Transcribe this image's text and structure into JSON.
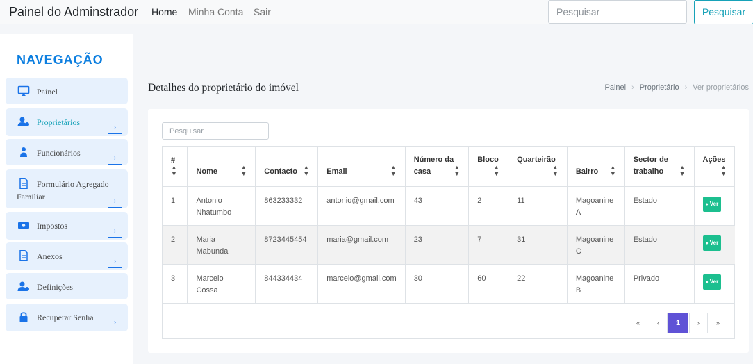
{
  "navbar": {
    "brand": "Painel do Adminstrador",
    "links": [
      "Home",
      "Minha Conta",
      "Sair"
    ],
    "search_placeholder": "Pesquisar",
    "search_button": "Pesquisar"
  },
  "sidebar": {
    "title": "NAVEGAÇÃO",
    "items": [
      {
        "label": "Painel",
        "icon": "monitor-icon"
      },
      {
        "label": "Proprietários",
        "icon": "user-group-icon",
        "active": true
      },
      {
        "label": "Funcionários",
        "icon": "worker-icon"
      },
      {
        "label": "Formulário Agregado Familiar",
        "icon": "document-icon"
      },
      {
        "label": "Impostos",
        "icon": "money-icon"
      },
      {
        "label": "Anexos",
        "icon": "document-icon"
      },
      {
        "label": "Definições",
        "icon": "user-group-icon"
      },
      {
        "label": "Recuperar Senha",
        "icon": "lock-icon"
      }
    ],
    "chevron": "›"
  },
  "page": {
    "title": "Detalhes do proprietário do imóvel",
    "breadcrumb": [
      "Painel",
      "Proprietário",
      "Ver proprietários"
    ],
    "breadcrumb_sep": "›"
  },
  "table": {
    "search_placeholder": "Pesquisar",
    "sort_icon": "sort-icon",
    "columns": [
      "#",
      "Nome",
      "Contacto",
      "Email",
      "Número da casa",
      "Bloco",
      "Quarteirão",
      "Bairro",
      "Sector de trabalho",
      "Ações"
    ],
    "rows": [
      {
        "n": "1",
        "nome": "Antonio Nhatumbo",
        "contacto": "863233332",
        "email": "antonio@gmail.com",
        "casa": "43",
        "bloco": "2",
        "quarteirao": "11",
        "bairro": "Magoanine A",
        "sector": "Estado",
        "acao": "Ver"
      },
      {
        "n": "2",
        "nome": "Maria Mabunda",
        "contacto": "8723445454",
        "email": "maria@gmail.com",
        "casa": "23",
        "bloco": "7",
        "quarteirao": "31",
        "bairro": "Magoanine C",
        "sector": "Estado",
        "acao": "Ver"
      },
      {
        "n": "3",
        "nome": "Marcelo Cossa",
        "contacto": "844334434",
        "email": "marcelo@gmail.com",
        "casa": "30",
        "bloco": "60",
        "quarteirao": "22",
        "bairro": "Magoanine B",
        "sector": "Privado",
        "acao": "Ver"
      }
    ]
  },
  "pagination": {
    "first": "«",
    "prev": "‹",
    "current": "1",
    "next": "›",
    "last": "»"
  },
  "colors": {
    "accent": "#0d7fe0",
    "info": "#17a2b8",
    "badge": "#1cbf8f",
    "page_active": "#5f52d6"
  }
}
